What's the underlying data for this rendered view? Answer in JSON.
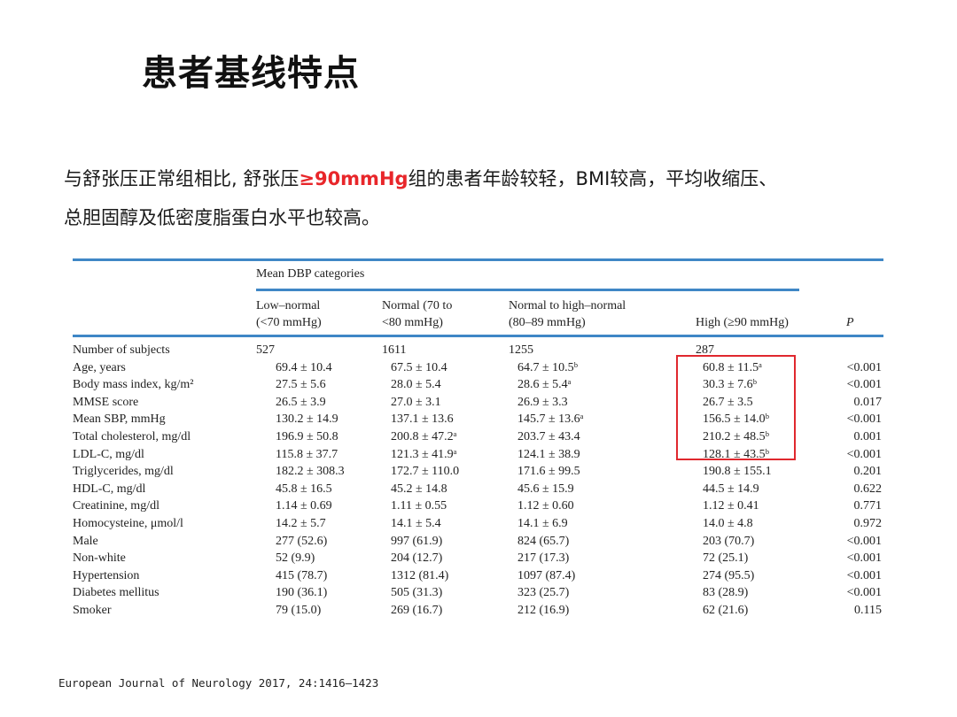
{
  "title": "患者基线特点",
  "summary": {
    "line1_pre": "与舒张压正常组相比, 舒张压",
    "line1_highlight": "≥90mmHg",
    "line1_post": "组的患者年龄较轻，BMI较高，平均收缩压、",
    "line2": "总胆固醇及低密度脂蛋白水平也较高。"
  },
  "table": {
    "group_label": "Mean DBP categories",
    "columns": [
      {
        "line1": "Low–normal",
        "line2": "(<70 mmHg)"
      },
      {
        "line1": "Normal (70 to",
        "line2": "<80 mmHg)"
      },
      {
        "line1": "Normal to high–normal",
        "line2": "(80–89 mmHg)"
      },
      {
        "line1": "",
        "line2": "High (≥90 mmHg)"
      },
      {
        "line1": "",
        "line2": "P"
      }
    ],
    "rows": [
      {
        "label": "Number of subjects",
        "v1": "527",
        "v2": "1611",
        "v3": "1255",
        "v4": "287",
        "p": ""
      },
      {
        "label": "Age, years",
        "v1": "69.4 ± 10.4",
        "v2": "67.5 ± 10.4",
        "v3": "64.7 ± 10.5ᵇ",
        "v4": "60.8 ± 11.5ᵃ",
        "p": "<0.001"
      },
      {
        "label": "Body mass index, kg/m²",
        "v1": "27.5 ± 5.6",
        "v2": "28.0 ± 5.4",
        "v3": "28.6 ± 5.4ᵃ",
        "v4": "30.3 ± 7.6ᵇ",
        "p": "<0.001"
      },
      {
        "label": "MMSE score",
        "v1": "26.5 ± 3.9",
        "v2": "27.0 ± 3.1",
        "v3": "26.9 ± 3.3",
        "v4": "26.7 ± 3.5",
        "p": "0.017"
      },
      {
        "label": "Mean SBP, mmHg",
        "v1": "130.2 ± 14.9",
        "v2": "137.1 ± 13.6",
        "v3": "145.7 ± 13.6ᵃ",
        "v4": "156.5 ± 14.0ᵇ",
        "p": "<0.001"
      },
      {
        "label": "Total cholesterol, mg/dl",
        "v1": "196.9 ± 50.8",
        "v2": "200.8 ± 47.2ᵃ",
        "v3": "203.7 ± 43.4",
        "v4": "210.2 ± 48.5ᵇ",
        "p": "0.001"
      },
      {
        "label": "LDL-C, mg/dl",
        "v1": "115.8 ± 37.7",
        "v2": "121.3 ± 41.9ᵃ",
        "v3": "124.1 ± 38.9",
        "v4": "128.1 ± 43.5ᵇ",
        "p": "<0.001"
      },
      {
        "label": "Triglycerides, mg/dl",
        "v1": "182.2 ± 308.3",
        "v2": "172.7 ± 110.0",
        "v3": "171.6 ± 99.5",
        "v4": "190.8 ± 155.1",
        "p": "0.201"
      },
      {
        "label": "HDL-C, mg/dl",
        "v1": "45.8 ± 16.5",
        "v2": "45.2 ± 14.8",
        "v3": "45.6 ± 15.9",
        "v4": "44.5 ± 14.9",
        "p": "0.622"
      },
      {
        "label": "Creatinine, mg/dl",
        "v1": "1.14 ± 0.69",
        "v2": "1.11 ± 0.55",
        "v3": "1.12 ± 0.60",
        "v4": "1.12 ± 0.41",
        "p": "0.771"
      },
      {
        "label": "Homocysteine, μmol/l",
        "v1": "14.2 ± 5.7",
        "v2": "14.1 ± 5.4",
        "v3": "14.1 ± 6.9",
        "v4": "14.0 ± 4.8",
        "p": "0.972"
      },
      {
        "label": "Male",
        "v1": "277 (52.6)",
        "v2": "997 (61.9)",
        "v3": "824 (65.7)",
        "v4": "203 (70.7)",
        "p": "<0.001"
      },
      {
        "label": "Non-white",
        "v1": "52 (9.9)",
        "v2": "204 (12.7)",
        "v3": "217 (17.3)",
        "v4": "72 (25.1)",
        "p": "<0.001"
      },
      {
        "label": "Hypertension",
        "v1": "415 (78.7)",
        "v2": "1312 (81.4)",
        "v3": "1097 (87.4)",
        "v4": "274 (95.5)",
        "p": "<0.001"
      },
      {
        "label": "Diabetes mellitus",
        "v1": "190 (36.1)",
        "v2": "505 (31.3)",
        "v3": "323 (25.7)",
        "v4": "83 (28.9)",
        "p": "<0.001"
      },
      {
        "label": "Smoker",
        "v1": "79 (15.0)",
        "v2": "269 (16.7)",
        "v3": "212 (16.9)",
        "v4": "62 (21.6)",
        "p": "0.115"
      }
    ]
  },
  "citation": "European Journal of Neurology 2017, 24:1416–1423",
  "colors": {
    "rule": "#3f87c6",
    "highlight": "#e8262a",
    "box": "#e0282e"
  }
}
